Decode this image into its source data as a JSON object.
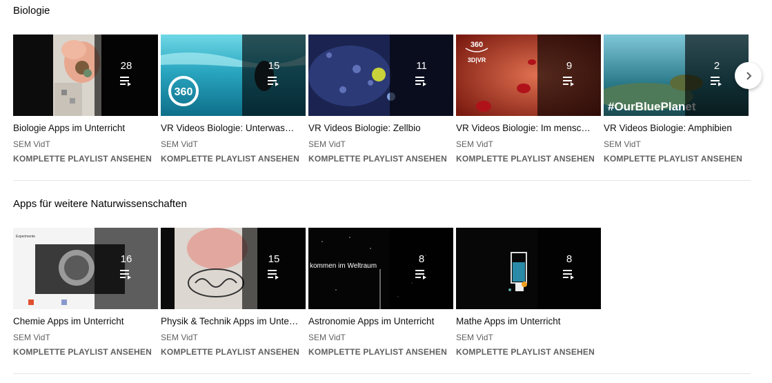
{
  "sections": [
    {
      "title": "Biologie",
      "cards": [
        {
          "title": "Biologie Apps im Unterricht",
          "channel": "SEM VidT",
          "link": "KOMPLETTE PLAYLIST ANSEHEN",
          "count": "28"
        },
        {
          "title": "VR Videos Biologie: Unterwasserwelt",
          "channel": "SEM VidT",
          "link": "KOMPLETTE PLAYLIST ANSEHEN",
          "count": "15"
        },
        {
          "title": "VR Videos Biologie: Zellbio",
          "channel": "SEM VidT",
          "link": "KOMPLETTE PLAYLIST ANSEHEN",
          "count": "11"
        },
        {
          "title": "VR Videos Biologie: Im menschlichen Körper",
          "channel": "SEM VidT",
          "link": "KOMPLETTE PLAYLIST ANSEHEN",
          "count": "9"
        },
        {
          "title": "VR Videos Biologie: Amphibien",
          "channel": "SEM VidT",
          "link": "KOMPLETTE PLAYLIST ANSEHEN",
          "count": "2"
        }
      ]
    },
    {
      "title": "Apps für weitere Naturwissenschaften",
      "cards": [
        {
          "title": "Chemie Apps im Unterricht",
          "channel": "SEM VidT",
          "link": "KOMPLETTE PLAYLIST ANSEHEN",
          "count": "16"
        },
        {
          "title": "Physik & Technik Apps im Unterricht",
          "channel": "SEM VidT",
          "link": "KOMPLETTE PLAYLIST ANSEHEN",
          "count": "15"
        },
        {
          "title": "Astronomie Apps im Unterricht",
          "channel": "SEM VidT",
          "link": "KOMPLETTE PLAYLIST ANSEHEN",
          "count": "8"
        },
        {
          "title": "Mathe Apps im Unterricht",
          "channel": "SEM VidT",
          "link": "KOMPLETTE PLAYLIST ANSEHEN",
          "count": "8"
        }
      ]
    }
  ],
  "thumb_text": {
    "badge_360": "360",
    "badge_3dvr": "3D|VR",
    "hashtag": "#OurBluePlanet",
    "weltraum": "kommen im Weltraum",
    "experimente": "Experimente"
  },
  "icons": {
    "playlist": "playlist-icon",
    "next": "chevron-right-icon"
  }
}
